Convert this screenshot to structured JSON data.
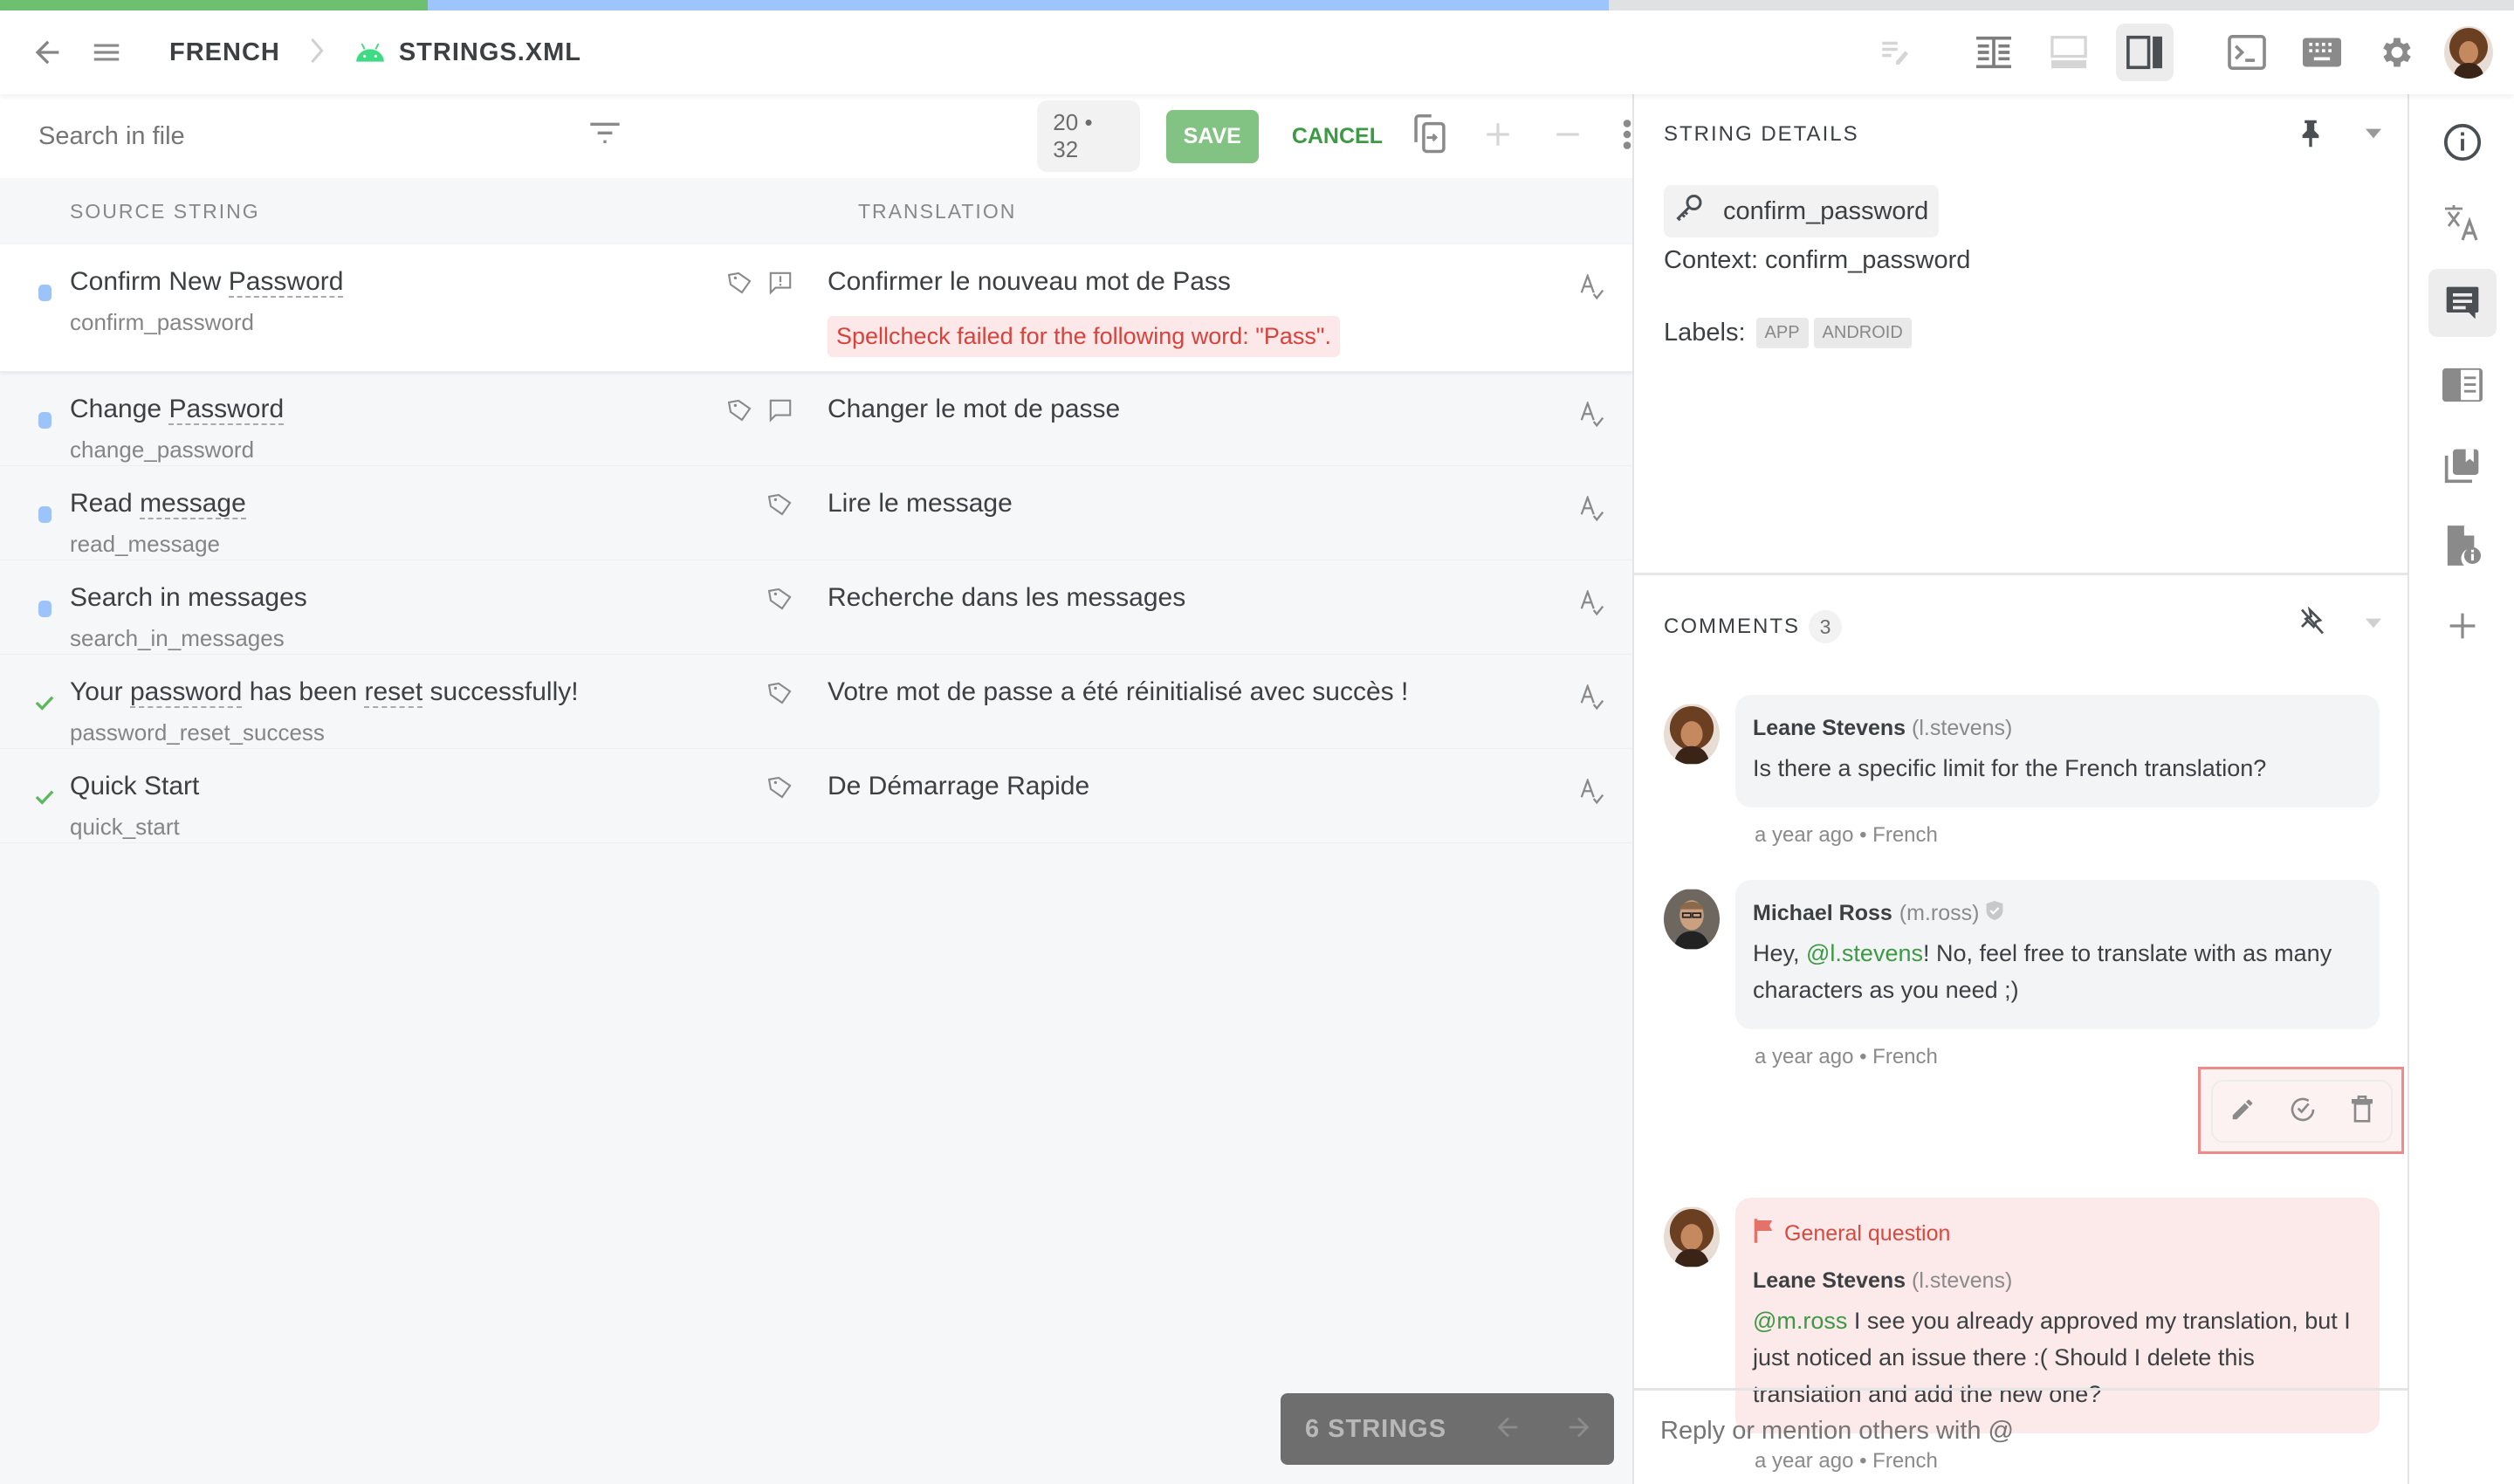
{
  "progress": {
    "translated_fraction": 0.17,
    "approved_or_total_fraction": 0.64,
    "colors": {
      "translated": "#6cc070",
      "approved": "#9ec5fb",
      "rest": "#e0e1e3"
    }
  },
  "topbar": {
    "breadcrumb": [
      "FRENCH",
      "STRINGS.XML"
    ],
    "icons": [
      "back-arrow-icon",
      "menu-icon",
      "android-icon",
      "edit-notes-icon",
      "side-by-side-view-icon",
      "bottom-panel-view-icon",
      "right-panel-view-icon",
      "terminal-icon",
      "keyboard-icon",
      "settings-gear-icon",
      "user-avatar"
    ]
  },
  "toolbar": {
    "search_placeholder": "Search in file",
    "counter": "20 • 32",
    "save_label": "SAVE",
    "cancel_label": "CANCEL"
  },
  "table": {
    "headers": {
      "source": "SOURCE STRING",
      "translation": "TRANSLATION"
    },
    "rows": [
      {
        "status": "untranslated-dot",
        "source_parts": [
          "Confirm New ",
          "Password",
          ""
        ],
        "key": "confirm_password",
        "translation": "Confirmer le nouveau mot de Pass",
        "spellcheck": "Spellcheck failed for the following word: \"Pass\".",
        "icons": [
          "tag-icon",
          "comment-issue-icon"
        ],
        "selected": true
      },
      {
        "status": "untranslated-dot",
        "source_parts": [
          "Change ",
          "Password",
          ""
        ],
        "key": "change_password",
        "translation": "Changer le mot de passe",
        "icons": [
          "tag-icon",
          "comment-icon"
        ]
      },
      {
        "status": "untranslated-dot",
        "source_parts": [
          "Read ",
          "message",
          ""
        ],
        "key": "read_message",
        "translation": "Lire le message",
        "icons": [
          "tag-icon"
        ]
      },
      {
        "status": "untranslated-dot",
        "source_parts": [
          "Search in messages",
          "",
          ""
        ],
        "key": "search_in_messages",
        "translation": "Recherche dans les messages",
        "icons": [
          "tag-icon"
        ]
      },
      {
        "status": "approved-check",
        "source_parts": [
          "Your ",
          "password",
          " has been ",
          "reset",
          " successfully!"
        ],
        "key": "password_reset_success",
        "translation": "Votre mot de passe a été réinitialisé avec succès !",
        "icons": [
          "tag-icon"
        ]
      },
      {
        "status": "approved-check",
        "source_parts": [
          "Quick Start",
          "",
          ""
        ],
        "key": "quick_start",
        "translation": "De Démarrage Rapide",
        "icons": [
          "tag-icon"
        ]
      }
    ],
    "footer": {
      "count_label": "6 STRINGS"
    }
  },
  "details": {
    "title": "STRING DETAILS",
    "key": "confirm_password",
    "context": "Context: confirm_password",
    "labels_title": "Labels:",
    "labels": [
      "APP",
      "ANDROID"
    ]
  },
  "comments": {
    "title": "COMMENTS",
    "count": "3",
    "items": [
      {
        "author": "Leane Stevens",
        "handle": "(l.stevens)",
        "text_parts": [
          "",
          "",
          "Is there a specific limit for the French translation?"
        ],
        "time": "a year ago",
        "language": "French"
      },
      {
        "author": "Michael Ross",
        "handle": "(m.ross)",
        "verified": true,
        "text_parts": [
          "Hey, ",
          "@l.stevens",
          "! No, feel free to translate with as many characters as you need ;)"
        ],
        "time": "a year ago",
        "language": "French"
      },
      {
        "author": "Leane Stevens",
        "handle": "(l.stevens)",
        "flag": "General question",
        "text_parts": [
          "",
          "@m.ross",
          " I see you already approved my translation, but I just noticed an issue there :( Should I delete this translation and add the new one?"
        ],
        "time": "a year ago",
        "language": "French"
      }
    ],
    "reply_placeholder": "Reply or mention others with @"
  },
  "rail": {
    "items": [
      "info-icon",
      "translate-icon",
      "comments-icon",
      "glossary-icon",
      "translation-memory-icon",
      "file-info-icon",
      "add-icon"
    ],
    "active": "comments-icon"
  }
}
